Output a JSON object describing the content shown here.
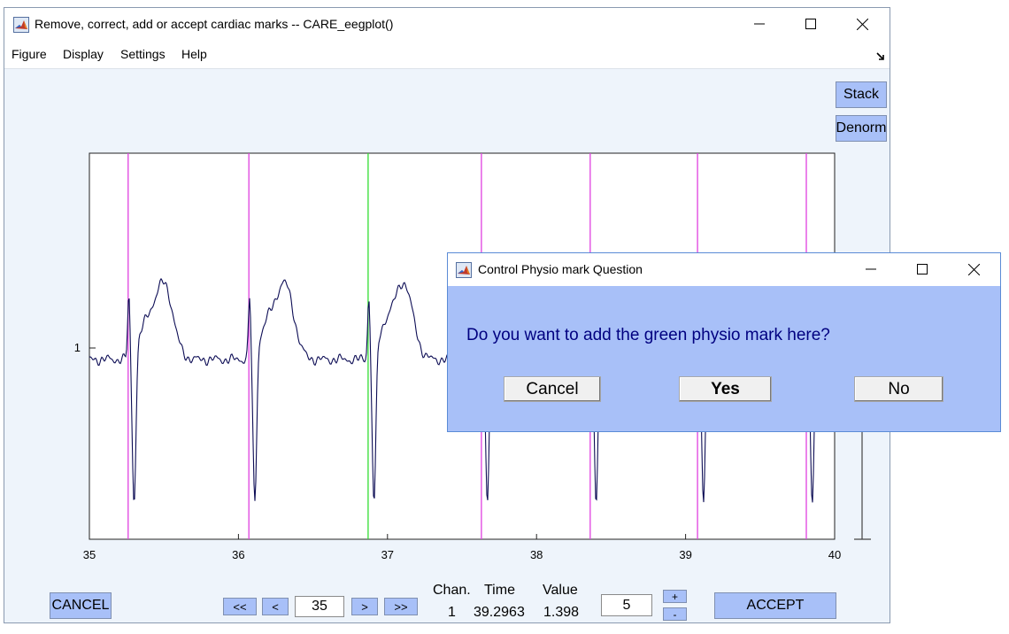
{
  "main_window": {
    "title": "Remove, correct, add or accept cardiac marks -- CARE_eegplot()",
    "icon": "matlab-icon"
  },
  "menu": [
    "Figure",
    "Display",
    "Settings",
    "Help"
  ],
  "side_buttons": {
    "stack": "Stack",
    "denorm": "Denorm"
  },
  "plot": {
    "y_tick_label": "1",
    "x_ticks": [
      "35",
      "36",
      "37",
      "38",
      "39",
      "40"
    ],
    "xlim": [
      35,
      40
    ],
    "magenta_marks": [
      35.26,
      36.07,
      37.63,
      38.36,
      39.08,
      39.81
    ],
    "green_mark": 36.87,
    "mark_colors": {
      "magenta": "#e040e0",
      "green": "#33dd33",
      "signal": "#0d0d55"
    }
  },
  "bottom": {
    "cancel": "CANCEL",
    "accept": "ACCEPT",
    "nav": {
      "first": "<<",
      "prev": "<",
      "next": ">",
      "last": ">>"
    },
    "time_box": "35",
    "readout_headers": {
      "chan": "Chan.",
      "time": "Time",
      "value": "Value"
    },
    "readout_values": {
      "chan": "1",
      "time": "39.2963",
      "value": "1.398"
    },
    "scale_box": "5",
    "plus": "+",
    "minus": "-"
  },
  "dialog": {
    "title": "Control Physio mark Question",
    "question": "Do you want to add the green physio mark here?",
    "buttons": {
      "cancel": "Cancel",
      "yes": "Yes",
      "no": "No"
    },
    "question_color": "#000080"
  }
}
